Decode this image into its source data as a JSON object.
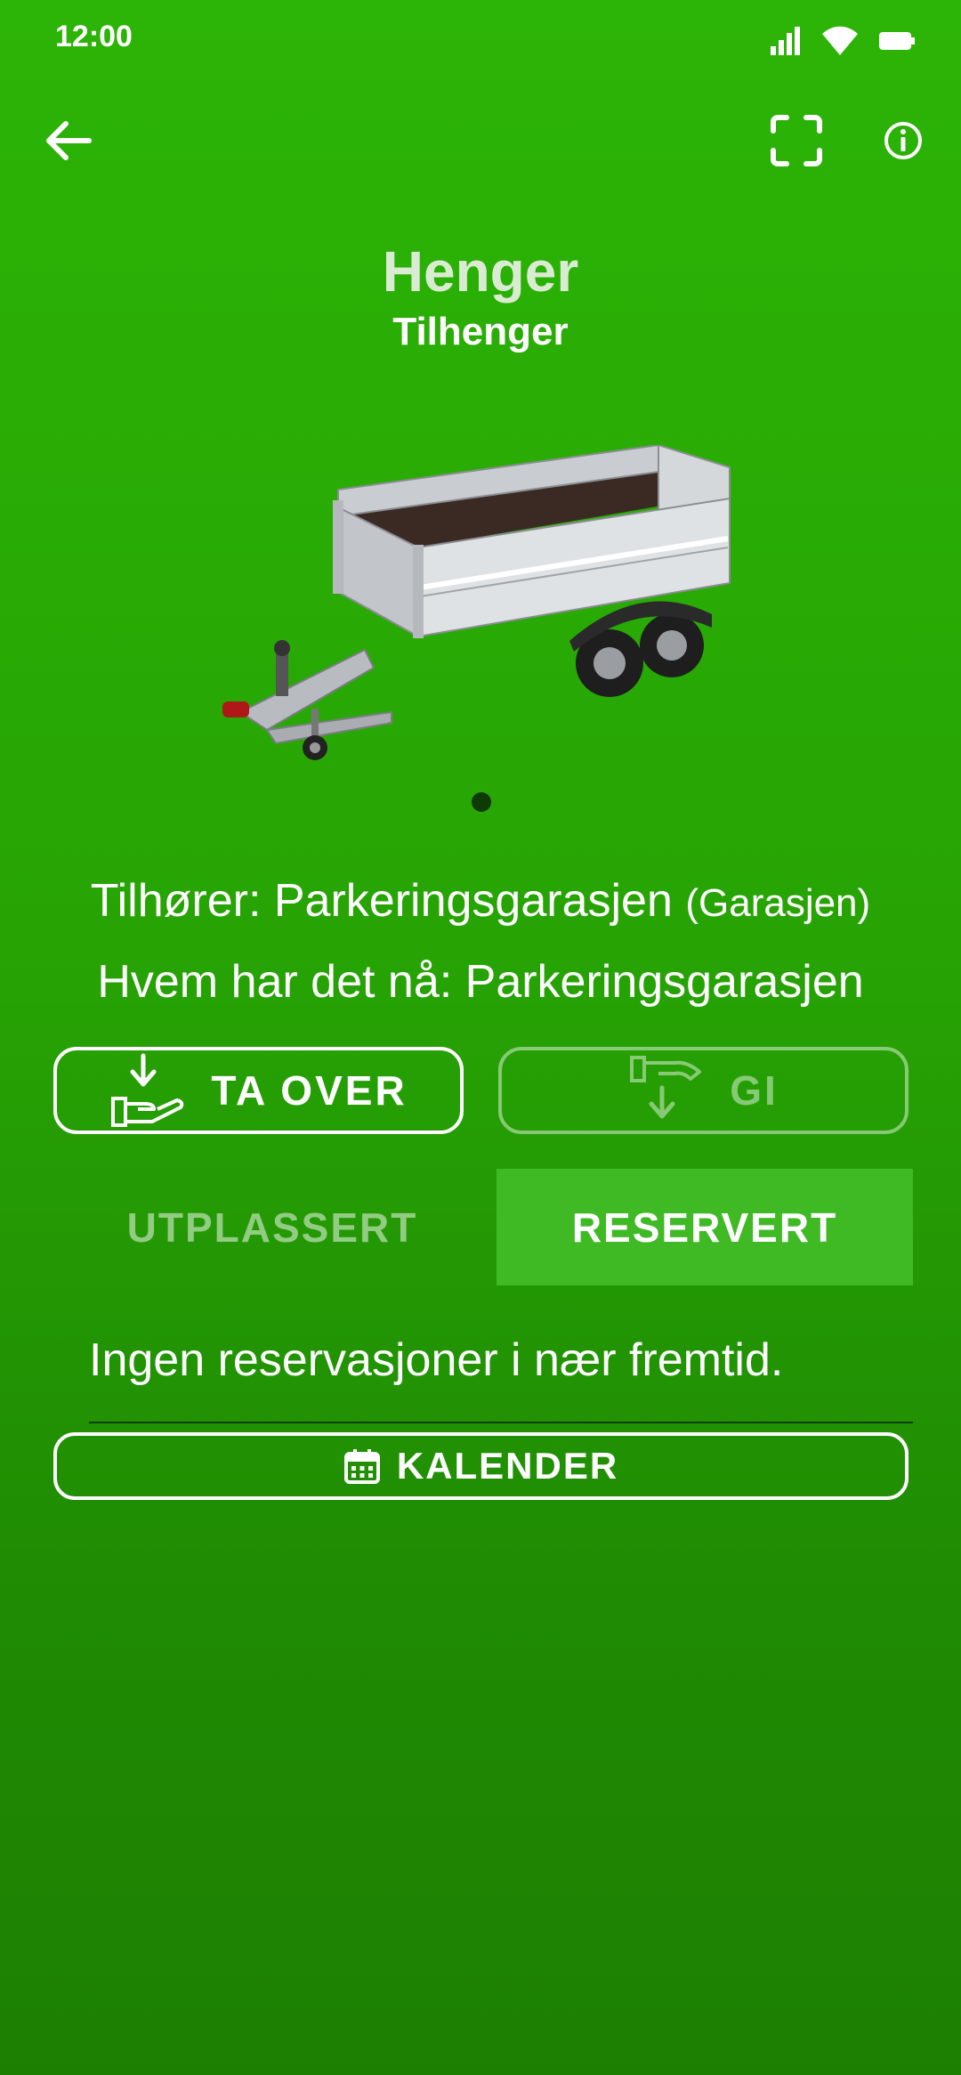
{
  "status_bar": {
    "time": "12:00"
  },
  "header": {
    "back_icon": "arrow-left-icon",
    "scan_icon": "scan-frame-icon",
    "info_icon": "info-circle-icon"
  },
  "item": {
    "title": "Henger",
    "subtitle": "Tilhenger",
    "image": "trailer-photo",
    "image_page": 1,
    "image_count": 1
  },
  "details": {
    "owner_label": "Tilhører: Parkeringsgarasjen",
    "owner_location": "(Garasjen)",
    "holder_label": "Hvem har det nå: Parkeringsgarasjen"
  },
  "actions": {
    "take_over_label": "TA OVER",
    "give_label": "GI",
    "give_enabled": false
  },
  "tabs": [
    {
      "label": "UTPLASSERT",
      "selected": false
    },
    {
      "label": "RESERVERT",
      "selected": true
    }
  ],
  "reservations": {
    "empty_text": "Ingen reservasjoner i nær fremtid.",
    "calendar_label": "KALENDER"
  },
  "colors": {
    "background_top": "#2cb406",
    "background_bottom": "#1d7f02",
    "tab_selected": "#3fba24",
    "white": "#ffffff"
  }
}
